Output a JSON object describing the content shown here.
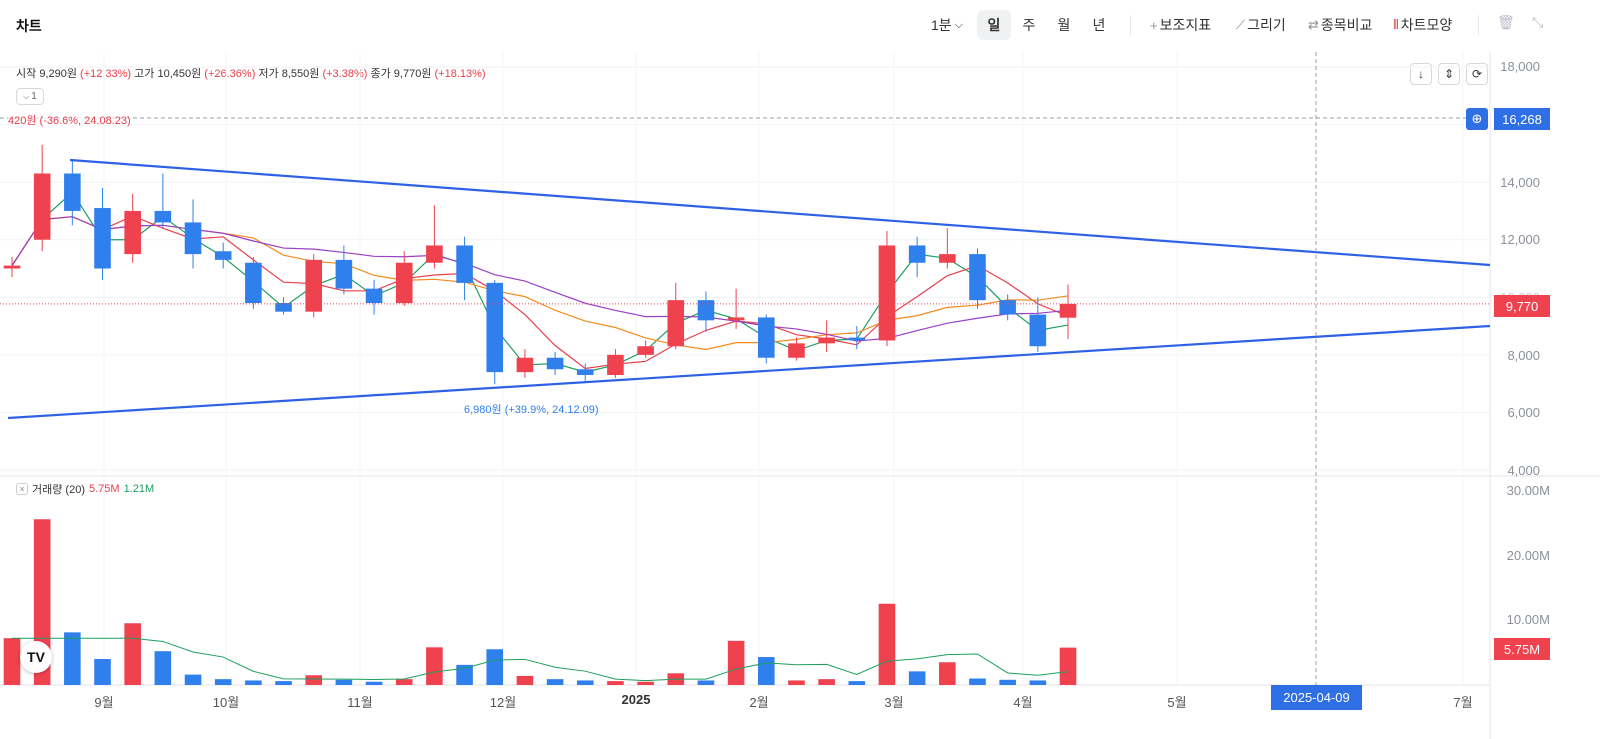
{
  "header": {
    "title": "차트",
    "interval_label": "1분",
    "periods": [
      "일",
      "주",
      "월",
      "년"
    ],
    "active_period": "일",
    "tools": [
      {
        "icon": "plus-icon",
        "glyph": "+",
        "label": "보조지표"
      },
      {
        "icon": "pencil-icon",
        "glyph": "⟋",
        "label": "그리기"
      },
      {
        "icon": "compare-icon",
        "glyph": "⇄",
        "label": "종목비교"
      },
      {
        "icon": "chart-shape-icon",
        "glyph": "⦀",
        "label": "차트모양"
      }
    ]
  },
  "ohlc_info": {
    "open_label": "시작",
    "open": "9,290원",
    "open_pct": "(+12.33%)",
    "high_label": "고가",
    "high": "10,450원",
    "high_pct": "(+26.36%)",
    "low_label": "저가",
    "low": "8,550원",
    "low_pct": "(+3.38%)",
    "close_label": "종가",
    "close": "9,770원",
    "close_pct": "(+18.13%)"
  },
  "collapse_pill": "1",
  "annotations": {
    "high_marker": "420원 (-36.6%, 24.08.23)",
    "low_marker": "6,980원 (+39.9%, 24.12.09)"
  },
  "price_axis": [
    "18,000",
    "16,000",
    "14,000",
    "12,000",
    "10,000",
    "8,000",
    "6,000",
    "4,000"
  ],
  "volume_axis": [
    "30.00M",
    "20.00M",
    "10.00M"
  ],
  "tags": {
    "crosshair_price": "16,268",
    "current_price": "9,770",
    "current_volume": "5.75M",
    "crosshair_date": "2025-04-09"
  },
  "volume_legend": {
    "label": "거래량 (20)",
    "value1": "5.75M",
    "value2": "1.21M"
  },
  "x_axis_labels": [
    "9월",
    "10월",
    "11월",
    "12월",
    "2025",
    "2월",
    "3월",
    "4월",
    "5월",
    "7월"
  ],
  "logo_text": "TV",
  "colors": {
    "up": "#f0414f",
    "down": "#2f80ed",
    "trendline": "#2e62e6",
    "ma5": "#1e9e60",
    "ma20": "#e8404d",
    "ma60": "#f38b1c",
    "ma120": "#9b3fc7",
    "accent": "#2f6fe6"
  },
  "chart_data": {
    "type": "candlestick",
    "price_range": [
      4000,
      18000
    ],
    "volume_range": [
      0,
      30000000
    ],
    "dates": [
      "2024-08-05",
      "2024-08-12",
      "2024-08-19",
      "2024-08-26",
      "2024-09-02",
      "2024-09-09",
      "2024-09-16",
      "2024-09-23",
      "2024-09-30",
      "2024-10-07",
      "2024-10-14",
      "2024-10-21",
      "2024-10-28",
      "2024-11-04",
      "2024-11-11",
      "2024-11-18",
      "2024-11-25",
      "2024-12-02",
      "2024-12-09",
      "2024-12-16",
      "2024-12-23",
      "2024-12-30",
      "2025-01-06",
      "2025-01-13",
      "2025-01-20",
      "2025-01-27",
      "2025-02-03",
      "2025-02-10",
      "2025-02-17",
      "2025-02-24",
      "2025-03-03",
      "2025-03-10",
      "2025-03-17",
      "2025-03-24",
      "2025-03-31",
      "2025-04-07"
    ],
    "candles": [
      {
        "o": 11000,
        "h": 11400,
        "l": 10700,
        "c": 11100
      },
      {
        "o": 12000,
        "h": 15300,
        "l": 11600,
        "c": 14300
      },
      {
        "o": 14300,
        "h": 14800,
        "l": 12500,
        "c": 13000
      },
      {
        "o": 13100,
        "h": 13800,
        "l": 10600,
        "c": 11000
      },
      {
        "o": 11500,
        "h": 13600,
        "l": 11200,
        "c": 13000
      },
      {
        "o": 13000,
        "h": 14300,
        "l": 12400,
        "c": 12600
      },
      {
        "o": 12600,
        "h": 13400,
        "l": 11000,
        "c": 11500
      },
      {
        "o": 11600,
        "h": 11900,
        "l": 11000,
        "c": 11300
      },
      {
        "o": 11200,
        "h": 11400,
        "l": 9600,
        "c": 9800
      },
      {
        "o": 9800,
        "h": 10000,
        "l": 9400,
        "c": 9500
      },
      {
        "o": 9500,
        "h": 11500,
        "l": 9300,
        "c": 11300
      },
      {
        "o": 11300,
        "h": 11800,
        "l": 10100,
        "c": 10300
      },
      {
        "o": 10300,
        "h": 10600,
        "l": 9400,
        "c": 9800
      },
      {
        "o": 9800,
        "h": 11600,
        "l": 9700,
        "c": 11200
      },
      {
        "o": 11200,
        "h": 13200,
        "l": 11000,
        "c": 11800
      },
      {
        "o": 11800,
        "h": 12100,
        "l": 9900,
        "c": 10500
      },
      {
        "o": 10500,
        "h": 10600,
        "l": 6980,
        "c": 7400
      },
      {
        "o": 7400,
        "h": 8200,
        "l": 7200,
        "c": 7900
      },
      {
        "o": 7900,
        "h": 8100,
        "l": 7300,
        "c": 7500
      },
      {
        "o": 7500,
        "h": 7700,
        "l": 7100,
        "c": 7300
      },
      {
        "o": 7300,
        "h": 8200,
        "l": 7200,
        "c": 8000
      },
      {
        "o": 8000,
        "h": 8500,
        "l": 7900,
        "c": 8300
      },
      {
        "o": 8300,
        "h": 10500,
        "l": 8200,
        "c": 9900
      },
      {
        "o": 9900,
        "h": 10200,
        "l": 8800,
        "c": 9200
      },
      {
        "o": 9200,
        "h": 10300,
        "l": 8900,
        "c": 9300
      },
      {
        "o": 9300,
        "h": 9400,
        "l": 7700,
        "c": 7900
      },
      {
        "o": 7900,
        "h": 8600,
        "l": 7800,
        "c": 8400
      },
      {
        "o": 8400,
        "h": 9200,
        "l": 8100,
        "c": 8600
      },
      {
        "o": 8600,
        "h": 9000,
        "l": 8200,
        "c": 8500
      },
      {
        "o": 8500,
        "h": 12300,
        "l": 8300,
        "c": 11800
      },
      {
        "o": 11800,
        "h": 12100,
        "l": 10700,
        "c": 11200
      },
      {
        "o": 11200,
        "h": 12400,
        "l": 11000,
        "c": 11500
      },
      {
        "o": 11500,
        "h": 11700,
        "l": 9600,
        "c": 9900
      },
      {
        "o": 9900,
        "h": 10100,
        "l": 9200,
        "c": 9400
      },
      {
        "o": 9400,
        "h": 10000,
        "l": 8100,
        "c": 8300
      },
      {
        "o": 9290,
        "h": 10450,
        "l": 8550,
        "c": 9770
      }
    ],
    "volumes": [
      7.2,
      25.5,
      8.1,
      4.0,
      9.5,
      5.2,
      1.6,
      0.9,
      0.7,
      0.6,
      1.5,
      0.8,
      0.5,
      0.9,
      5.8,
      3.1,
      5.5,
      1.4,
      0.9,
      0.7,
      0.6,
      0.5,
      1.8,
      0.7,
      6.8,
      4.3,
      0.7,
      0.9,
      0.6,
      12.5,
      2.1,
      3.5,
      1.0,
      0.8,
      0.7,
      5.75
    ],
    "volume_unit": "M"
  }
}
